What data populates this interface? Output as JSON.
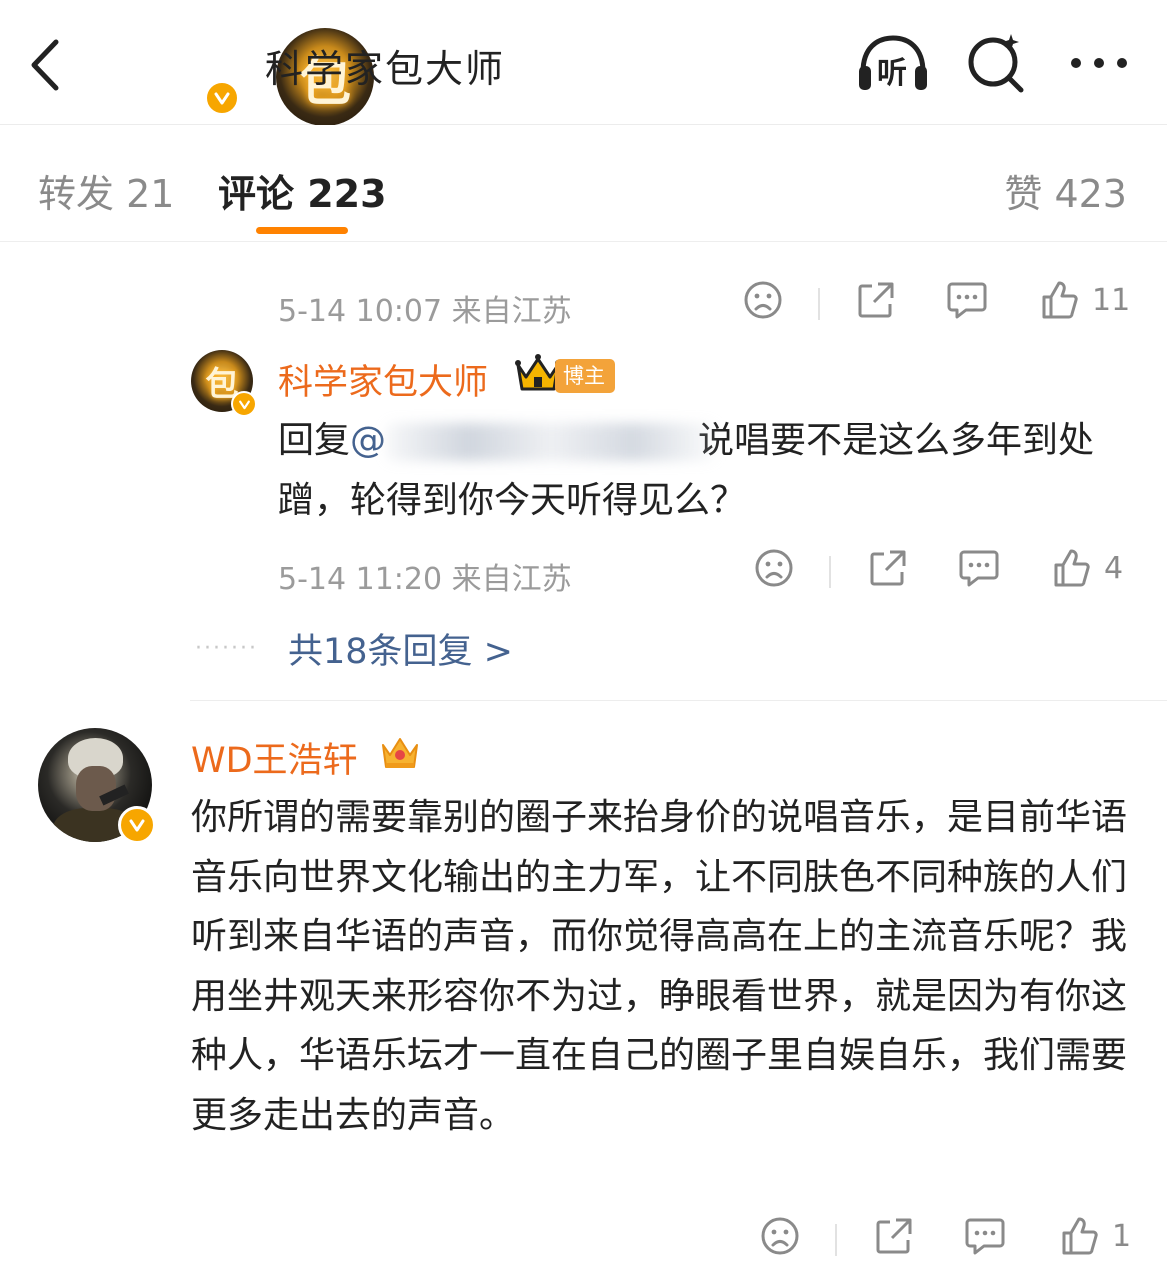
{
  "header": {
    "title": "科学家包大师",
    "avatar_glyph": "包",
    "listen_label": "听"
  },
  "tabs": {
    "repost": "转发 21",
    "comments": "评论 223",
    "likes": "赞 423"
  },
  "first_comment": {
    "time_location": "5-14 10:07 来自江苏",
    "like_count": "11"
  },
  "reply": {
    "username": "科学家包大师",
    "badge": "博主",
    "reply_prefix": "回复",
    "mention_at": "@",
    "text": "说唱要不是这么多年到处蹭，轮得到你今天听得见么？",
    "time_location": "5-14 11:20 来自江苏",
    "like_count": "4"
  },
  "more_replies": {
    "label": "共18条回复 >"
  },
  "second_comment": {
    "username": "WD王浩轩",
    "text": "你所谓的需要靠别的圈子来抬身价的说唱音乐，是目前华语音乐向世界文化输出的主力军，让不同肤色不同种族的人们听到来自华语的声音，而你觉得高高在上的主流音乐呢？我用坐井观天来形容你不为过，睁眼看世界，就是因为有你这种人，华语乐坛才一直在自己的圈子里自娱自乐，我们需要更多走出去的声音。",
    "like_count": "1"
  },
  "colors": {
    "accent": "#ff8200",
    "username": "#ec6a1c",
    "link": "#44628f",
    "verified": "#f7a600",
    "meta": "#9b9b9b"
  },
  "icons": [
    "back-arrow-icon",
    "headphones-icon",
    "search-icon",
    "more-icon",
    "sad-face-icon",
    "share-icon",
    "comment-icon",
    "thumbs-up-icon",
    "crown-icon",
    "verified-icon"
  ]
}
